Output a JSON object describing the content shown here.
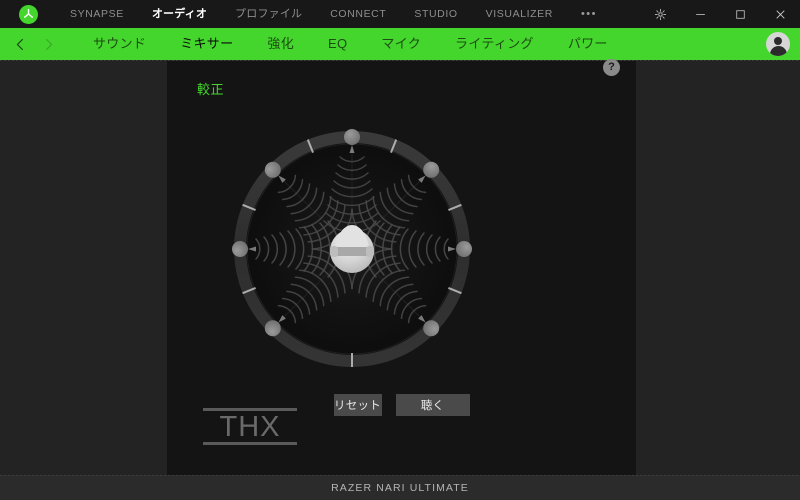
{
  "window": {
    "logo_icon": "razer-logo-icon",
    "title_tabs": [
      {
        "label": "SYNAPSE",
        "active": false,
        "jp": false
      },
      {
        "label": "オーディオ",
        "active": true,
        "jp": true
      },
      {
        "label": "プロファイル",
        "active": false,
        "jp": true
      },
      {
        "label": "CONNECT",
        "active": false,
        "jp": false
      },
      {
        "label": "STUDIO",
        "active": false,
        "jp": false
      },
      {
        "label": "VISUALIZER",
        "active": false,
        "jp": false
      }
    ],
    "overflow_label": "•••",
    "controls": {
      "settings": "gear-icon",
      "minimize": "minimize-icon",
      "maximize": "maximize-icon",
      "close": "close-icon"
    }
  },
  "nav": {
    "back_icon": "chevron-left-icon",
    "forward_icon": "chevron-right-icon",
    "items": [
      {
        "label": "サウンド",
        "active": false
      },
      {
        "label": "ミキサー",
        "active": true
      },
      {
        "label": "強化",
        "active": false
      },
      {
        "label": "EQ",
        "active": false
      },
      {
        "label": "マイク",
        "active": false
      },
      {
        "label": "ライティング",
        "active": false
      },
      {
        "label": "パワー",
        "active": false
      }
    ],
    "avatar": "user-avatar-icon",
    "accent_color": "#44d62c"
  },
  "content": {
    "section_title": "較正",
    "help_label": "?",
    "calibration": {
      "center_icon": "listener-head-icon",
      "speaker_count": 7,
      "speaker_angles_deg": [
        0,
        45,
        90,
        135,
        225,
        270,
        315
      ],
      "tick_angles_deg": [
        22,
        68,
        112,
        158,
        180,
        202,
        248,
        292,
        338
      ]
    },
    "buttons": [
      {
        "label": "リセット",
        "name": "reset-button"
      },
      {
        "label": "聴く",
        "name": "listen-button"
      }
    ],
    "brand_logo": "THX"
  },
  "statusbar": {
    "device_name": "RAZER NARI ULTIMATE"
  }
}
